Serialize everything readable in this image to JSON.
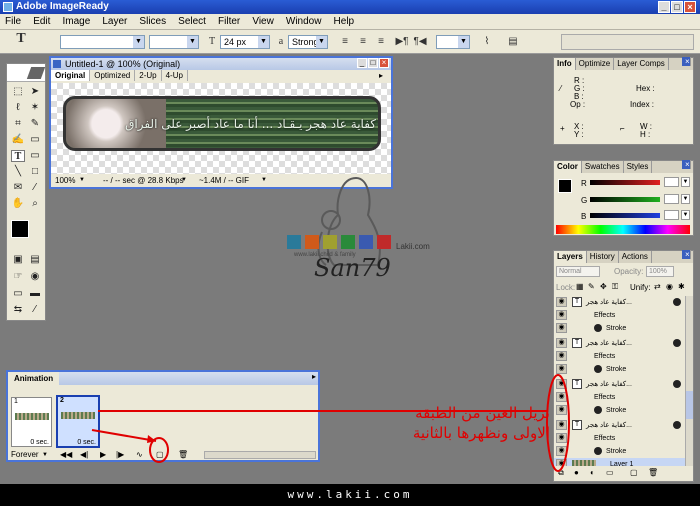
{
  "window": {
    "title": "Adobe ImageReady"
  },
  "menu": [
    "File",
    "Edit",
    "Image",
    "Layer",
    "Slices",
    "Select",
    "Filter",
    "View",
    "Window",
    "Help"
  ],
  "options_bar": {
    "text_tool_label": "T",
    "font_size": "24 px",
    "aa_label": "a",
    "antialias": "Strong"
  },
  "document": {
    "title": "Untitled-1 @ 100% (Original)",
    "tabs": [
      "Original",
      "Optimized",
      "2-Up",
      "4-Up"
    ],
    "active_tab": "Original",
    "banner_text": "كفاية عاد هجر يـقـاد ... أنا ما عاد أصبر على الفراق",
    "zoom": "100%",
    "speed": "-- / -- sec @ 28.8 Kbps",
    "size": "~1.4M / -- GIF"
  },
  "info_panel": {
    "tabs": [
      "Info",
      "Optimize",
      "Layer Comps"
    ],
    "fields": [
      "R :",
      "G :",
      "B :",
      "Op :",
      "Hex :",
      "Index :",
      "X :",
      "Y :",
      "W :",
      "H :"
    ]
  },
  "color_panel": {
    "tabs": [
      "Color",
      "Swatches",
      "Styles"
    ],
    "channels": [
      {
        "label": "R",
        "color": "#e02020"
      },
      {
        "label": "G",
        "color": "#20b020"
      },
      {
        "label": "B",
        "color": "#2040e0"
      }
    ]
  },
  "layers_panel": {
    "tabs": [
      "Layers",
      "History",
      "Actions"
    ],
    "blend_mode": "Normal",
    "opacity_label": "Opacity:",
    "opacity_value": "100%",
    "lock_label": "Lock:",
    "unify_label": "Unify:",
    "rows": [
      {
        "type": "layer",
        "name": "كفاية عاد هجر..."
      },
      {
        "type": "effects",
        "name": "Effects"
      },
      {
        "type": "stroke",
        "name": "Stroke"
      },
      {
        "type": "layer",
        "name": "كفاية عاد هجر..."
      },
      {
        "type": "effects",
        "name": "Effects"
      },
      {
        "type": "stroke",
        "name": "Stroke"
      },
      {
        "type": "layer",
        "name": "كفاية عاد هجر..."
      },
      {
        "type": "effects",
        "name": "Effects"
      },
      {
        "type": "stroke",
        "name": "Stroke"
      },
      {
        "type": "layer",
        "name": "كفاية عاد هجر..."
      },
      {
        "type": "effects",
        "name": "Effects"
      },
      {
        "type": "stroke",
        "name": "Stroke"
      },
      {
        "type": "layer",
        "name": "Layer 1"
      }
    ]
  },
  "animation_panel": {
    "title": "Animation",
    "frames": [
      {
        "number": "1",
        "delay": "0 sec."
      },
      {
        "number": "2",
        "delay": "0 sec."
      }
    ],
    "loop": "Forever"
  },
  "annotation": {
    "line1": "نزيل العين من الطبقة",
    "line2": "الاولى ونظهرها بالثانية",
    "color": "#e00000"
  },
  "watermark": {
    "brand_text": "Lakii.com",
    "tagline": "www.lakii.child & family",
    "signature": "San79"
  },
  "footer": {
    "url": "www.lakii.com"
  }
}
